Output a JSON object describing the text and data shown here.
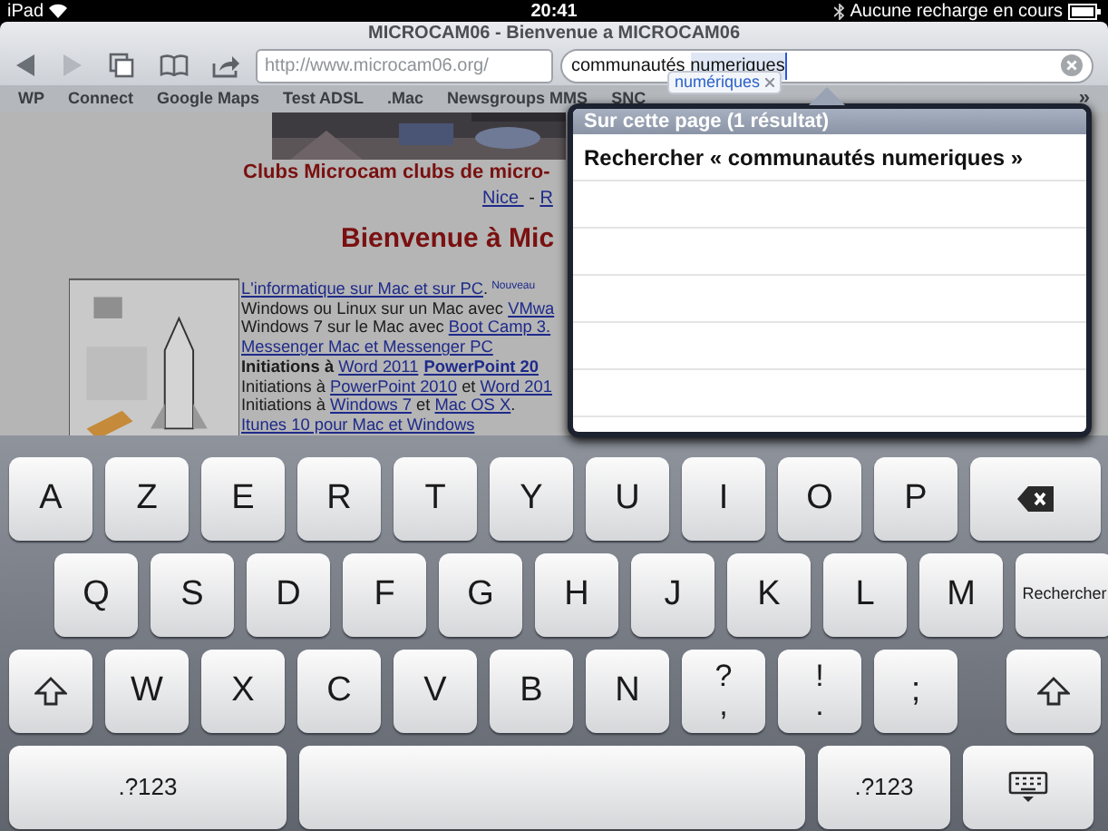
{
  "status_bar": {
    "device": "iPad",
    "time": "20:41",
    "battery_text": "Aucune recharge en cours"
  },
  "browser": {
    "title": "MICROCAM06 - Bienvenue a MICROCAM06",
    "back_enabled": true,
    "forward_enabled": false,
    "url": "http://www.microcam06.org/",
    "search": {
      "typed": "communautés ",
      "marked": "numeriques"
    },
    "suggestion": "numériques"
  },
  "bookmarks": [
    "WP",
    "Connect",
    "Google Maps",
    "Test ADSL",
    ".Mac",
    "Newsgroups MMS",
    "SNC"
  ],
  "bookmarks_more": "»",
  "page": {
    "heading": "Clubs Microcam clubs de micro-",
    "city_links": [
      {
        "kind": "link",
        "text": "Nice "
      },
      {
        "kind": "plain",
        "text": " - "
      },
      {
        "kind": "link",
        "text": "R"
      }
    ],
    "welcome": "Bienvenue à Mic",
    "lines": [
      [
        {
          "kind": "link",
          "text": "L'informatique sur Mac et sur PC"
        },
        {
          "kind": "plain",
          "text": "."
        },
        {
          "kind": "sup",
          "text": "Nouveau"
        }
      ],
      [
        {
          "kind": "plain",
          "text": "Windows ou Linux sur un Mac avec "
        },
        {
          "kind": "link",
          "text": "VMwa"
        }
      ],
      [
        {
          "kind": "plain",
          "text": "Windows 7 sur le Mac avec "
        },
        {
          "kind": "link",
          "text": "Boot Camp 3."
        }
      ],
      [
        {
          "kind": "link",
          "text": "Messenger Mac et Messenger PC"
        }
      ],
      [
        {
          "kind": "bold",
          "text": "Initiations à "
        },
        {
          "kind": "link",
          "text": "Word 2011"
        },
        {
          "kind": "bold_link",
          "text": "PowerPoint 20"
        }
      ],
      [
        {
          "kind": "plain",
          "text": "Initiations à "
        },
        {
          "kind": "link",
          "text": "PowerPoint 2010"
        },
        {
          "kind": "plain",
          "text": " et "
        },
        {
          "kind": "link",
          "text": "Word 201"
        }
      ],
      [
        {
          "kind": "plain",
          "text": "Initiations à "
        },
        {
          "kind": "link",
          "text": "Windows 7"
        },
        {
          "kind": "plain",
          "text": " et "
        },
        {
          "kind": "link",
          "text": "Mac OS X"
        },
        {
          "kind": "plain",
          "text": "."
        }
      ],
      [
        {
          "kind": "link",
          "text": "Itunes 10 pour Mac et Windows"
        }
      ]
    ]
  },
  "popover": {
    "header": "Sur cette page (1 résultat)",
    "rows": [
      "Rechercher « communautés numeriques »"
    ]
  },
  "keyboard": {
    "rows": [
      [
        {
          "kind": "char",
          "label": "A"
        },
        {
          "kind": "char",
          "label": "Z"
        },
        {
          "kind": "char",
          "label": "E"
        },
        {
          "kind": "char",
          "label": "R"
        },
        {
          "kind": "char",
          "label": "T"
        },
        {
          "kind": "char",
          "label": "Y"
        },
        {
          "kind": "char",
          "label": "U"
        },
        {
          "kind": "char",
          "label": "I"
        },
        {
          "kind": "char",
          "label": "O"
        },
        {
          "kind": "char",
          "label": "P"
        },
        {
          "kind": "backspace"
        }
      ],
      [
        {
          "kind": "char",
          "label": "Q"
        },
        {
          "kind": "char",
          "label": "S"
        },
        {
          "kind": "char",
          "label": "D"
        },
        {
          "kind": "char",
          "label": "F"
        },
        {
          "kind": "char",
          "label": "G"
        },
        {
          "kind": "char",
          "label": "H"
        },
        {
          "kind": "char",
          "label": "J"
        },
        {
          "kind": "char",
          "label": "K"
        },
        {
          "kind": "char",
          "label": "L"
        },
        {
          "kind": "char",
          "label": "M"
        },
        {
          "kind": "return",
          "label": "Rechercher"
        }
      ],
      [
        {
          "kind": "shift"
        },
        {
          "kind": "char",
          "label": "W"
        },
        {
          "kind": "char",
          "label": "X"
        },
        {
          "kind": "char",
          "label": "C"
        },
        {
          "kind": "char",
          "label": "V"
        },
        {
          "kind": "char",
          "label": "B"
        },
        {
          "kind": "char",
          "label": "N"
        },
        {
          "kind": "dual",
          "top": "?",
          "bottom": ","
        },
        {
          "kind": "dual",
          "top": "!",
          "bottom": "."
        },
        {
          "kind": "char",
          "label": ";"
        },
        {
          "kind": "shift"
        }
      ]
    ],
    "bottom_row": [
      {
        "kind": "mode",
        "label": ".?123"
      },
      {
        "kind": "space"
      },
      {
        "kind": "mode",
        "label": ".?123"
      },
      {
        "kind": "hide"
      }
    ]
  }
}
